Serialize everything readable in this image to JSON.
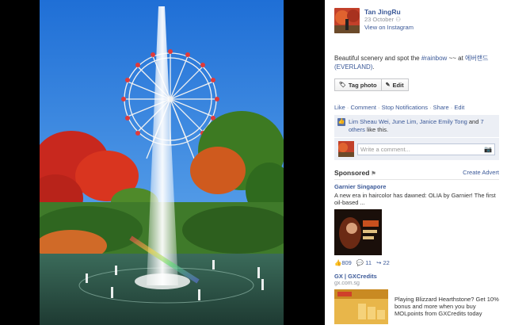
{
  "post": {
    "author": "Tan JingRu",
    "date": "23 October",
    "via": "View on Instagram",
    "caption_prefix": "Beautiful scenery and spot the ",
    "caption_hashtag": "#rainbow",
    "caption_mid": " ~~ at ",
    "caption_place": "에버랜드 (EVERLAND)",
    "caption_suffix": "."
  },
  "buttons": {
    "tag_photo": "Tag photo",
    "edit": "Edit"
  },
  "actions": [
    "Like",
    "Comment",
    "Stop Notifications",
    "Share",
    "Edit"
  ],
  "likes": {
    "names": "Lim Sheau Wei, June Lim, Janice Emily Tong",
    "conjunction": " and ",
    "others": "7 others",
    "suffix": " like this."
  },
  "comment": {
    "placeholder": "Write a comment..."
  },
  "sponsored": {
    "title": "Sponsored",
    "create_advert": "Create Advert"
  },
  "ads": [
    {
      "title": "Garnier Singapore",
      "text": "A new era in haircolor has dawned: OLIA by Garnier! The first oil-based ...",
      "likes": "809",
      "comments": "11",
      "shares": "22"
    },
    {
      "title": "GX | GXCredits",
      "subtitle": "gx.com.sg",
      "text": "Playing Blizzard Hearthstone? Get 10% bonus and more when you buy MOLpoints from GXCredits today"
    }
  ],
  "colors": {
    "link": "#3b5998",
    "panel_bg": "#ffffff",
    "stage_bg": "#000000"
  }
}
